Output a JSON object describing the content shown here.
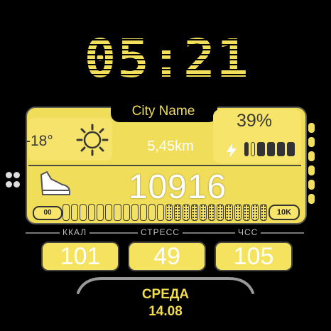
{
  "time": "05:21",
  "city": "City Name",
  "weather": {
    "temperature": "-18°",
    "icon": "sun-icon"
  },
  "distance": "5,45km",
  "battery": {
    "percent": "39%",
    "level": 0.39,
    "icon": "lightning-icon"
  },
  "steps": {
    "count": "10916",
    "scale_min": "00",
    "scale_max": "10K",
    "icon": "shoe-icon"
  },
  "stats": {
    "kcal": {
      "label": "ККАЛ",
      "value": "101"
    },
    "stress": {
      "label": "СТРЕСС",
      "value": "49"
    },
    "hr": {
      "label": "ЧСС",
      "value": "105"
    }
  },
  "date": {
    "weekday": "СРЕДА",
    "day": "14.08"
  },
  "colors": {
    "accent": "#f0dd59",
    "background": "#000000",
    "outline": "#45453f"
  }
}
